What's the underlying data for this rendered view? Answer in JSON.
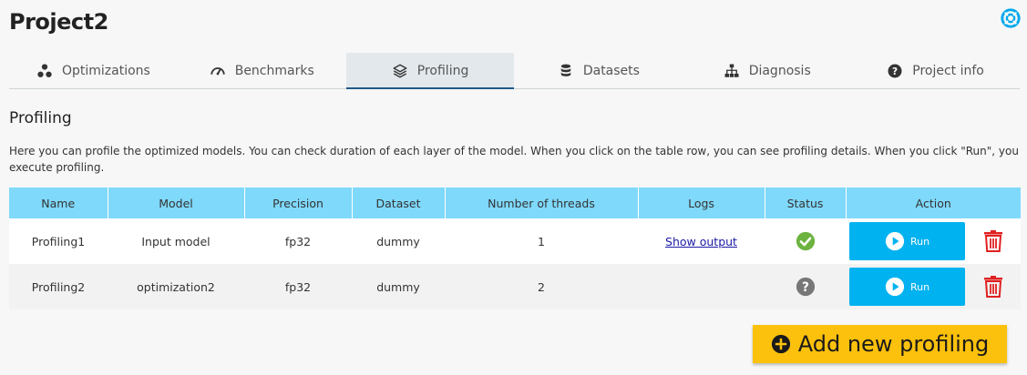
{
  "project": {
    "title": "Project2"
  },
  "header": {
    "help_icon": "lifebuoy-icon"
  },
  "tabs": [
    {
      "label": "Optimizations",
      "icon": "molecule-icon"
    },
    {
      "label": "Benchmarks",
      "icon": "gauge-icon"
    },
    {
      "label": "Profiling",
      "icon": "layers-icon",
      "active": true
    },
    {
      "label": "Datasets",
      "icon": "database-icon"
    },
    {
      "label": "Diagnosis",
      "icon": "sitemap-icon"
    },
    {
      "label": "Project info",
      "icon": "question-circle-icon"
    }
  ],
  "section": {
    "title": "Profiling",
    "description": "Here you can profile the optimized models. You can check duration of each layer of the model. When you click on the table row, you can see profiling details. When you click \"Run\", you execute profiling."
  },
  "table": {
    "columns": [
      "Name",
      "Model",
      "Precision",
      "Dataset",
      "Number of threads",
      "Logs",
      "Status",
      "Action"
    ],
    "rows": [
      {
        "name": "Profiling1",
        "model": "Input model",
        "precision": "fp32",
        "dataset": "dummy",
        "threads": "1",
        "logs": "Show output",
        "status": "success",
        "action": "Run"
      },
      {
        "name": "Profiling2",
        "model": "optimization2",
        "precision": "fp32",
        "dataset": "dummy",
        "threads": "2",
        "logs": "",
        "status": "unknown",
        "action": "Run"
      }
    ]
  },
  "add_button": {
    "label": "Add new profiling"
  },
  "colors": {
    "header_bg": "#7fd9fb",
    "run_button": "#00b2f0",
    "add_button": "#fcc10c",
    "delete_icon": "#e02020",
    "status_success": "#6cb33f",
    "status_unknown": "#777777",
    "help_icon": "#00a9ec"
  }
}
